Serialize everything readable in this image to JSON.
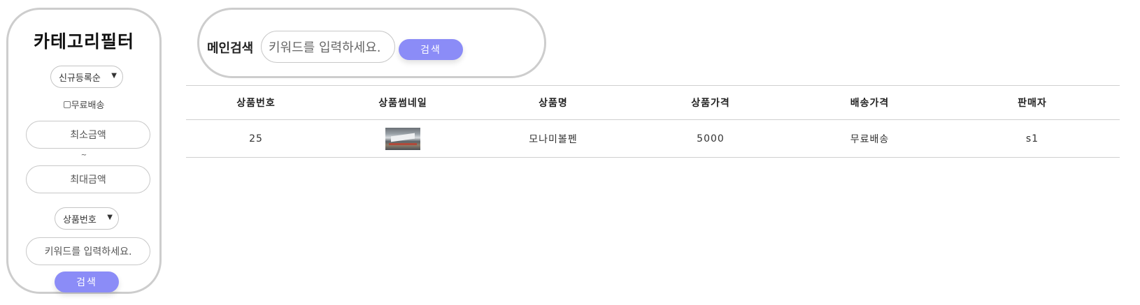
{
  "filter": {
    "title": "카테고리필터",
    "sort_select": "신규등록순",
    "free_shipping_label": "무료배송",
    "free_shipping_checked": false,
    "min_price_placeholder": "최소금액",
    "range_separator": "~",
    "max_price_placeholder": "최대금액",
    "field_select": "상품번호",
    "keyword_placeholder": "키워드를 입력하세요.",
    "search_button": "검색",
    "dropdown_arrow": "▼"
  },
  "main_search": {
    "label": "메인검색",
    "placeholder": "키워드를 입력하세요.",
    "button": "검색"
  },
  "table": {
    "headers": [
      "상품번호",
      "상품썸네일",
      "상품명",
      "상품가격",
      "배송가격",
      "판매자"
    ],
    "rows": [
      {
        "product_no": "25",
        "thumbnail": "product-thumbnail",
        "name": "모나미볼펜",
        "price": "5000",
        "shipping": "무료배송",
        "seller": "s1"
      }
    ]
  },
  "colors": {
    "accent": "#8b8cf7",
    "border": "#cdcdcd"
  }
}
